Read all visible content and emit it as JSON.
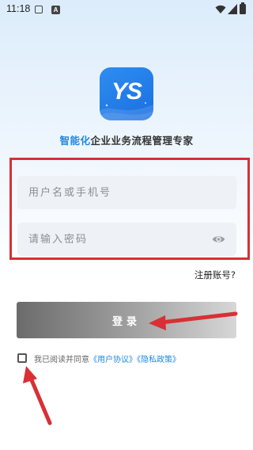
{
  "status_bar": {
    "time": "11:18",
    "icons": [
      "notification-square-icon",
      "text-a-icon",
      "wifi-icon",
      "signal-icon",
      "battery-icon"
    ],
    "a_glyph": "A"
  },
  "logo": {
    "text": "YS",
    "colors": [
      "#2f8df0",
      "#1a6fe0"
    ]
  },
  "slogan": {
    "accent": "智能化",
    "rest": "企业业务流程管理专家"
  },
  "form": {
    "username_placeholder": "用户名或手机号",
    "username_value": "",
    "password_placeholder": "请输入密码",
    "password_value": ""
  },
  "register_label": "注册账号?",
  "login_label": "登录",
  "agreement": {
    "checked": false,
    "prefix": "我已阅读并同意",
    "user_agreement": "《用户协议》",
    "privacy_policy": "《隐私政策》"
  },
  "colors": {
    "accent": "#1e88e5",
    "annotation_red": "#d83034"
  }
}
